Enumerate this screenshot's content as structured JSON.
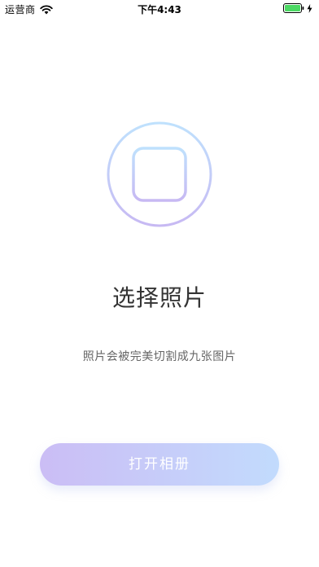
{
  "status_bar": {
    "carrier": "运营商",
    "time": "下午4:43",
    "battery_color": "#4cd964"
  },
  "picker": {
    "icon": "add-photo-icon",
    "gradient_start": "#c7b9f3",
    "gradient_end": "#bfe1fd"
  },
  "main": {
    "title": "选择照片",
    "subtitle": "照片会被完美切割成九张图片"
  },
  "action": {
    "open_album_label": "打开相册",
    "gradient_start": "#cbbdf5",
    "gradient_end": "#c2dbfd"
  }
}
